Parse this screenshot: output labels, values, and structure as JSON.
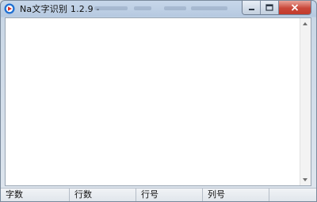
{
  "window": {
    "title": "Na文字识别 1.2.9 -"
  },
  "titlebar_buttons": [
    "minimize-icon",
    "maximize-icon",
    "close-icon"
  ],
  "editor": {
    "value": ""
  },
  "status_bar": {
    "char_count_label": "字数",
    "line_count_label": "行数",
    "line_number_label": "行号",
    "column_number_label": "列号",
    "extra": ""
  },
  "colors": {
    "close_button": "#c9483a",
    "title_bar": "#b6c9e0",
    "app_icon": "#1f6fd1"
  }
}
